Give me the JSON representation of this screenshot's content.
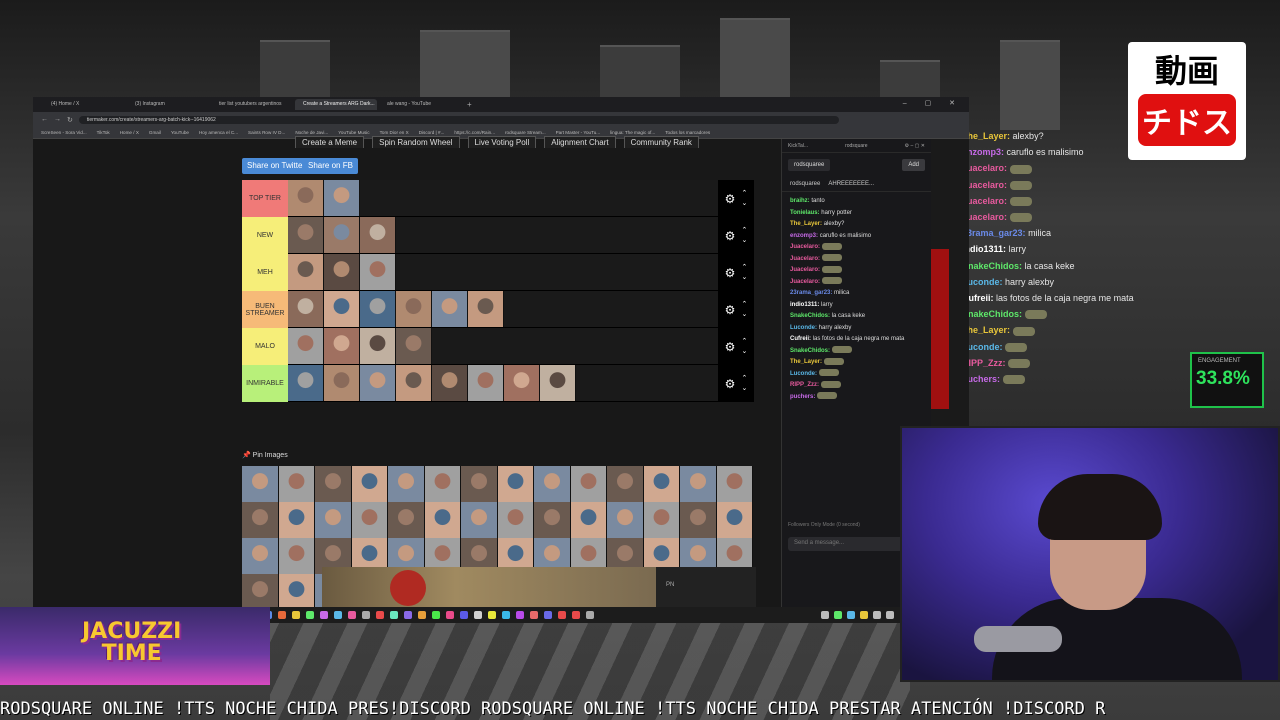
{
  "browser": {
    "tabs": [
      "(4) Home / X",
      "(3) Instagram",
      "tier list youtubers argentinos",
      "Create a Streamers ARG Dark...",
      "ale wang - YouTube"
    ],
    "url": "tiermaker.com/create/streamers-arg-batch-kick--16419062",
    "bookmarks": [
      "ScreSeen - Sora Vid...",
      "TikTok",
      "Home / X",
      "Gmail",
      "YouTube",
      "Hoy amenca el C...",
      "Saints Row IV D...",
      "Noche de Javi...",
      "YouTube Music",
      "Tom Dior en X",
      "Discord | #...",
      "https://c.com/Rain...",
      "rodsquare Stream...",
      "Part Master - YouTu...",
      "lingua: The magic of...",
      "Todos los marcadores"
    ]
  },
  "page": {
    "top_links": [
      "Create a Meme",
      "Spin Random Wheel",
      "Live Voting Poll",
      "Alignment Chart",
      "Community Rank"
    ],
    "share_twitter": "Share on Twitter",
    "share_fb": "Share on FB",
    "pin_images": "Pin Images",
    "tiers": [
      {
        "label": "TOP TIER",
        "color": "#f07a78",
        "count": 2
      },
      {
        "label": "NEW",
        "color": "#f6ee79",
        "count": 3
      },
      {
        "label": "MEH",
        "color": "#f6ee79",
        "count": 3
      },
      {
        "label": "BUEN STREAMER",
        "color": "#f6ba78",
        "count": 6
      },
      {
        "label": "MALO",
        "color": "#f6ee79",
        "count": 4
      },
      {
        "label": "INMIRABLE",
        "color": "#b8f07a",
        "count": 8
      }
    ],
    "pool_count": 56
  },
  "kick": {
    "title": "KickTal...",
    "channel": "rodsquare",
    "tab": "rodsquaree",
    "add": "Add",
    "sub_user": "rodsquaree",
    "sub_msg": "AHREEEEEEE...",
    "messages": [
      {
        "user": "braihz:",
        "color": "#5ee86a",
        "text": "tanto"
      },
      {
        "user": "Tonielaus:",
        "color": "#5ee86a",
        "text": "harry potter"
      },
      {
        "user": "The_Layer:",
        "color": "#e8c63a",
        "text": "alexby?"
      },
      {
        "user": "enzomp3:",
        "color": "#c76ae8",
        "text": "caruflo es malisimo"
      },
      {
        "user": "Juacelaro:",
        "color": "#e85a9e",
        "text": ""
      },
      {
        "user": "Juacelaro:",
        "color": "#e85a9e",
        "text": ""
      },
      {
        "user": "Juacelaro:",
        "color": "#e85a9e",
        "text": ""
      },
      {
        "user": "Juacelaro:",
        "color": "#e85a9e",
        "text": ""
      },
      {
        "user": "23rama_gar23:",
        "color": "#6a8ae8",
        "text": "milica"
      },
      {
        "user": "indio1311:",
        "color": "#ffffff",
        "text": "larry"
      },
      {
        "user": "SnakeChidos:",
        "color": "#5ee86a",
        "text": "la casa keke"
      },
      {
        "user": "Luconde:",
        "color": "#5ab8e8",
        "text": "harry alexby"
      },
      {
        "user": "Cufreii:",
        "color": "#ffffff",
        "text": "las fotos de la caja negra me mata"
      },
      {
        "user": "SnakeChidos:",
        "color": "#5ee86a",
        "text": ""
      },
      {
        "user": "The_Layer:",
        "color": "#e8c63a",
        "text": ""
      },
      {
        "user": "Luconde:",
        "color": "#5ab8e8",
        "text": ""
      },
      {
        "user": "RIPP_Zzz:",
        "color": "#e85a9e",
        "text": ""
      },
      {
        "user": "puchers:",
        "color": "#c76ae8",
        "text": ""
      }
    ],
    "mode": "Followers Only Mode (0 second)",
    "input_placeholder": "Send a message..."
  },
  "overlay_chat": [
    {
      "user": "The_Layer:",
      "color": "#e8c63a",
      "text": "alexby?"
    },
    {
      "user": "enzomp3:",
      "color": "#c76ae8",
      "text": "caruflo es malisimo"
    },
    {
      "user": "Juacelaro:",
      "color": "#e85a9e",
      "text": ""
    },
    {
      "user": "Juacelaro:",
      "color": "#e85a9e",
      "text": ""
    },
    {
      "user": "Juacelaro:",
      "color": "#e85a9e",
      "text": ""
    },
    {
      "user": "Juacelaro:",
      "color": "#e85a9e",
      "text": ""
    },
    {
      "user": "23rama_gar23:",
      "color": "#6a8ae8",
      "text": "milica"
    },
    {
      "user": "indio1311:",
      "color": "#ffffff",
      "text": "larry"
    },
    {
      "user": "SnakeChidos:",
      "color": "#5ee86a",
      "text": "la casa keke"
    },
    {
      "user": "Luconde:",
      "color": "#5ab8e8",
      "text": "harry alexby"
    },
    {
      "user": "Cufreii:",
      "color": "#ffffff",
      "text": "las fotos de la caja negra me mata"
    },
    {
      "user": "SnakeChidos:",
      "color": "#5ee86a",
      "text": ""
    },
    {
      "user": "The_Layer:",
      "color": "#e8c63a",
      "text": ""
    },
    {
      "user": "Luconde:",
      "color": "#5ab8e8",
      "text": ""
    },
    {
      "user": "RIPP_Zzz:",
      "color": "#e85a9e",
      "text": ""
    },
    {
      "user": "puchers:",
      "color": "#c76ae8",
      "text": ""
    }
  ],
  "logo": {
    "line1": "動画",
    "line2": "チドス"
  },
  "engagement": {
    "label": "ENGAGEMENT",
    "value": "33.8%"
  },
  "jacuzzi": {
    "line1": "JACUZZI",
    "line2": "TIME"
  },
  "clip_label": "PN",
  "ticker": "RODSQUARE ONLINE !TTS NOCHE CHIDA PRES!DISCORD RODSQUARE ONLINE !TTS NOCHE CHIDA PRESTAR ATENCIÓN !DISCORD R"
}
